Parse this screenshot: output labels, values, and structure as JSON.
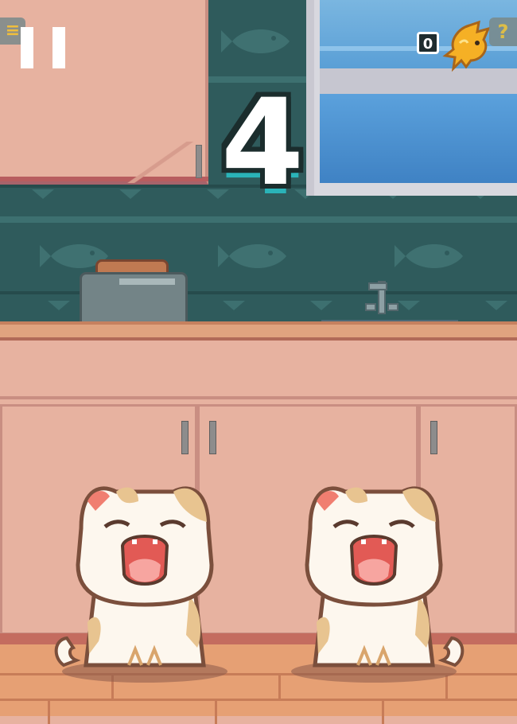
{
  "hud": {
    "menu_icon": "≡",
    "score": "4",
    "fish_count": "0",
    "help_icon": "?"
  },
  "icons": {
    "menu": "menu-icon",
    "pause": "pause-icon",
    "goldfish": "goldfish-icon",
    "help": "question-icon"
  },
  "colors": {
    "wallpaper": "#2f5b5c",
    "cabinet": "#e7b2a0",
    "counter": "#e0a37f",
    "floor": "#e6a074",
    "score_text": "#ffffff",
    "score_shadow": "#2ab3b8",
    "goldfish": "#f5b025",
    "hud_icon": "#f1c12e"
  }
}
